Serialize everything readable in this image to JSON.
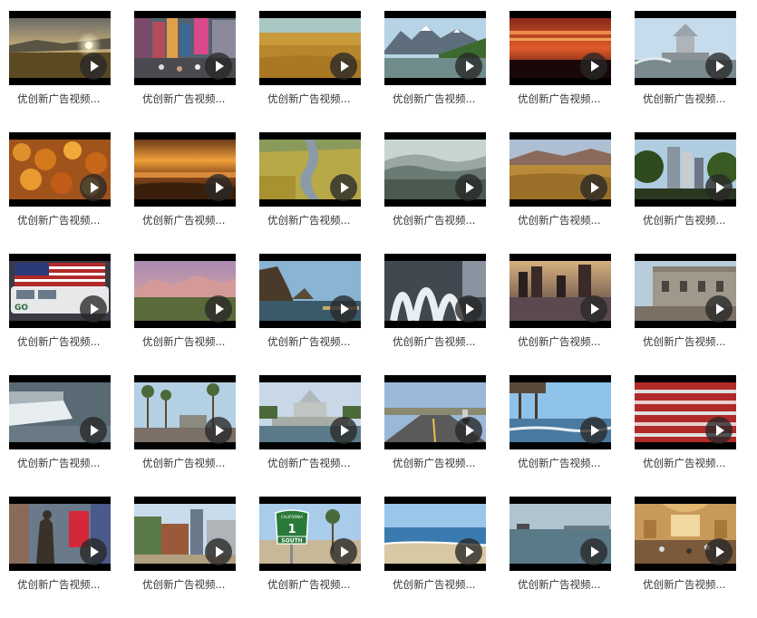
{
  "colors": {
    "background": "#ffffff",
    "caption_text": "#333333",
    "letterbox": "#000000",
    "play_badge": "#282828"
  },
  "videos": [
    {
      "title": "优创新广告视频...",
      "scene": "sunset-field",
      "icon": "play-icon"
    },
    {
      "title": "优创新广告视频...",
      "scene": "times-square",
      "icon": "play-icon"
    },
    {
      "title": "优创新广告视频...",
      "scene": "golden-prairie",
      "icon": "play-icon"
    },
    {
      "title": "优创新广告视频...",
      "scene": "mountain-lake",
      "icon": "play-icon"
    },
    {
      "title": "优创新广告视频...",
      "scene": "red-sky",
      "icon": "play-icon"
    },
    {
      "title": "优创新广告视频...",
      "scene": "fountain-plaza",
      "icon": "play-icon"
    },
    {
      "title": "优创新广告视频...",
      "scene": "autumn-leaves",
      "icon": "play-icon"
    },
    {
      "title": "优创新广告视频...",
      "scene": "orange-sunset",
      "icon": "play-icon"
    },
    {
      "title": "优创新广告视频...",
      "scene": "river-marsh",
      "icon": "play-icon"
    },
    {
      "title": "优创新广告视频...",
      "scene": "glacier-ice",
      "icon": "play-icon"
    },
    {
      "title": "优创新广告视频...",
      "scene": "valley-meadow",
      "icon": "play-icon"
    },
    {
      "title": "优创新广告视频...",
      "scene": "city-trees",
      "icon": "play-icon"
    },
    {
      "title": "优创新广告视频...",
      "scene": "flag-van",
      "icon": "play-icon"
    },
    {
      "title": "优创新广告视频...",
      "scene": "pink-mountains",
      "icon": "play-icon"
    },
    {
      "title": "优创新广告视频...",
      "scene": "coastal-rocks",
      "icon": "play-icon"
    },
    {
      "title": "优创新广告视频...",
      "scene": "fountain-spray",
      "icon": "play-icon"
    },
    {
      "title": "优创新广告视频...",
      "scene": "harbor-skyline",
      "icon": "play-icon"
    },
    {
      "title": "优创新广告视频...",
      "scene": "grand-building",
      "icon": "play-icon"
    },
    {
      "title": "优创新广告视频...",
      "scene": "waterfall",
      "icon": "play-icon"
    },
    {
      "title": "优创新广告视频...",
      "scene": "palm-boardwalk",
      "icon": "play-icon"
    },
    {
      "title": "优创新广告视频...",
      "scene": "fountain-park",
      "icon": "play-icon"
    },
    {
      "title": "优创新广告视频...",
      "scene": "road-cyclist",
      "icon": "play-icon"
    },
    {
      "title": "优创新广告视频...",
      "scene": "pier-ocean",
      "icon": "play-icon"
    },
    {
      "title": "优创新广告视频...",
      "scene": "red-steps",
      "icon": "play-icon"
    },
    {
      "title": "优创新广告视频...",
      "scene": "statue-city",
      "icon": "play-icon"
    },
    {
      "title": "优创新广告视频...",
      "scene": "street-buildings",
      "icon": "play-icon"
    },
    {
      "title": "优创新广告视频...",
      "scene": "route-sign",
      "icon": "play-icon"
    },
    {
      "title": "优创新广告视频...",
      "scene": "beach-coast",
      "icon": "play-icon"
    },
    {
      "title": "优创新广告视频...",
      "scene": "sea-ship",
      "icon": "play-icon"
    },
    {
      "title": "优创新广告视频...",
      "scene": "grand-hall",
      "icon": "play-icon"
    }
  ],
  "route_sign": {
    "top": "CALIFORNIA",
    "number": "1",
    "bottom": "SOUTH"
  }
}
